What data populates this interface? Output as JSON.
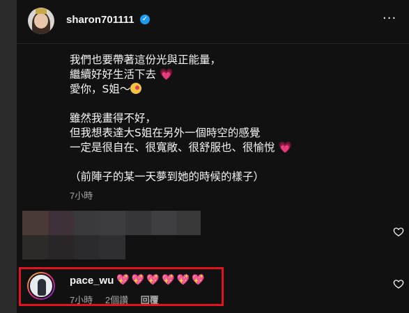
{
  "post": {
    "username": "sharon701111",
    "verified_badge": "✓",
    "more_icon": "···",
    "caption_lines": [
      "我們也要帶著這份光與正能量，",
      "繼續好好生活下去",
      "愛你，S姐～",
      "",
      "雖然我畫得不好，",
      "但我想表達大S姐在另外一個時空的感覺",
      "一定是很自在、很寬敞、很舒服也、很愉悅",
      "",
      "（前陣子的某一天夢到她的時候的樣子）"
    ],
    "heart_emoji": "💗",
    "time": "7小時"
  },
  "comment": {
    "username": "pace_wu",
    "text": "💖💖💖💖💖💖",
    "time": "7小時",
    "likes": "2個讚",
    "reply": "回覆"
  },
  "colors": {
    "background": "#111111",
    "highlight_border": "#e4121f",
    "verified": "#1d9bf0",
    "muted_text": "#a8a8a8"
  },
  "icons": {
    "like_comment_1": "heart-outline-icon",
    "like_comment_2": "heart-outline-icon"
  }
}
